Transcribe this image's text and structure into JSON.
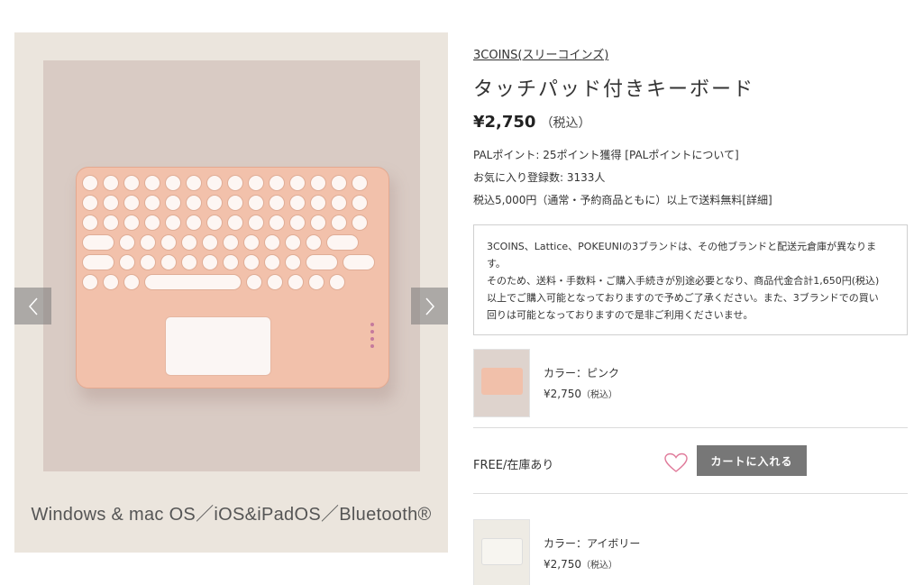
{
  "gallery": {
    "caption": "Windows & mac OS／iOS&iPadOS／Bluetooth®",
    "prev_icon": "chevron-left-icon",
    "next_icon": "chevron-right-icon"
  },
  "product": {
    "brand": "3COINS(スリーコインズ)",
    "title": "タッチパッド付きキーボード",
    "price": "¥2,750",
    "tax": "（税込）",
    "points": "PALポイント: 25ポイント獲得 [PALポイントについて]",
    "favorites": "お気に入り登録数: 3133人",
    "shipping": "税込5,000円（通常・予約商品ともに）以上で送料無料[詳細]"
  },
  "notice": {
    "line1": "3COINS、Lattice、POKEUNIの3ブランドは、その他ブランドと配送元倉庫が異なりま",
    "line2": "す。",
    "line3": "そのため、送料・手数料・ご購入手続きが別途必要となり、商品代金合計1,650円(税込)",
    "line4": "以上でご購入可能となっておりますので予めご了承ください。また、3ブランドでの買い",
    "line5": "回りは可能となっておりますので是非ご利用くださいませ。"
  },
  "variants": [
    {
      "color": "カラー：ピンク",
      "price": "¥2,750",
      "tax": "（税込）"
    },
    {
      "color": "カラー：アイボリー",
      "price": "¥2,750",
      "tax": "（税込）"
    }
  ],
  "purchase": {
    "stock": "FREE/在庫あり",
    "cart_label": "カートに入れる",
    "heart_icon": "heart-icon"
  },
  "colors": {
    "button_bg": "#777777",
    "heart": "#e07a9a",
    "gallery_bg": "#ebe5dd",
    "photo_bg": "#d9cbc4",
    "keyboard_pink": "#f2c1ab"
  }
}
